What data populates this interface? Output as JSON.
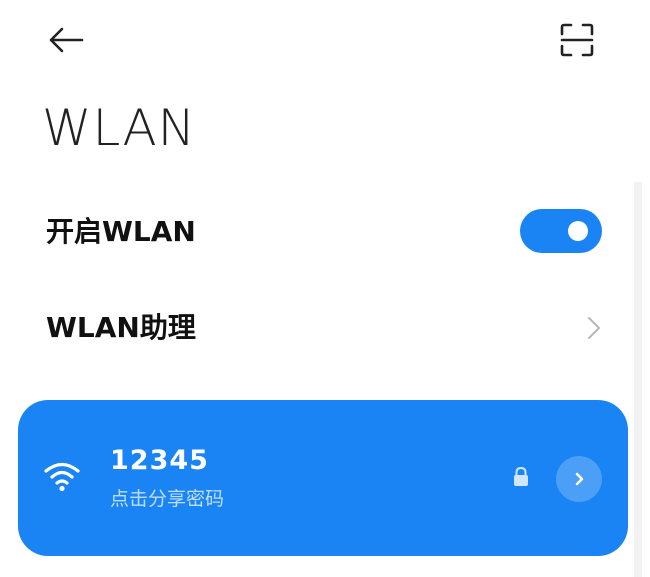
{
  "header": {
    "back_icon": "arrow-left-icon",
    "scan_icon": "scan-frame-icon"
  },
  "page": {
    "title": "WLAN"
  },
  "settings": {
    "wlan_toggle": {
      "label": "开启WLAN",
      "enabled": true
    },
    "assistant": {
      "label": "WLAN助理",
      "icon": "chevron-right-icon"
    }
  },
  "connected_network": {
    "name": "12345",
    "subtitle": "点击分享密码",
    "secured": true,
    "icons": {
      "signal": "wifi-icon",
      "security": "lock-icon",
      "details": "chevron-right-circle-icon"
    }
  },
  "colors": {
    "accent": "#1a84f5",
    "background": "#ffffff",
    "text": "#111111"
  }
}
